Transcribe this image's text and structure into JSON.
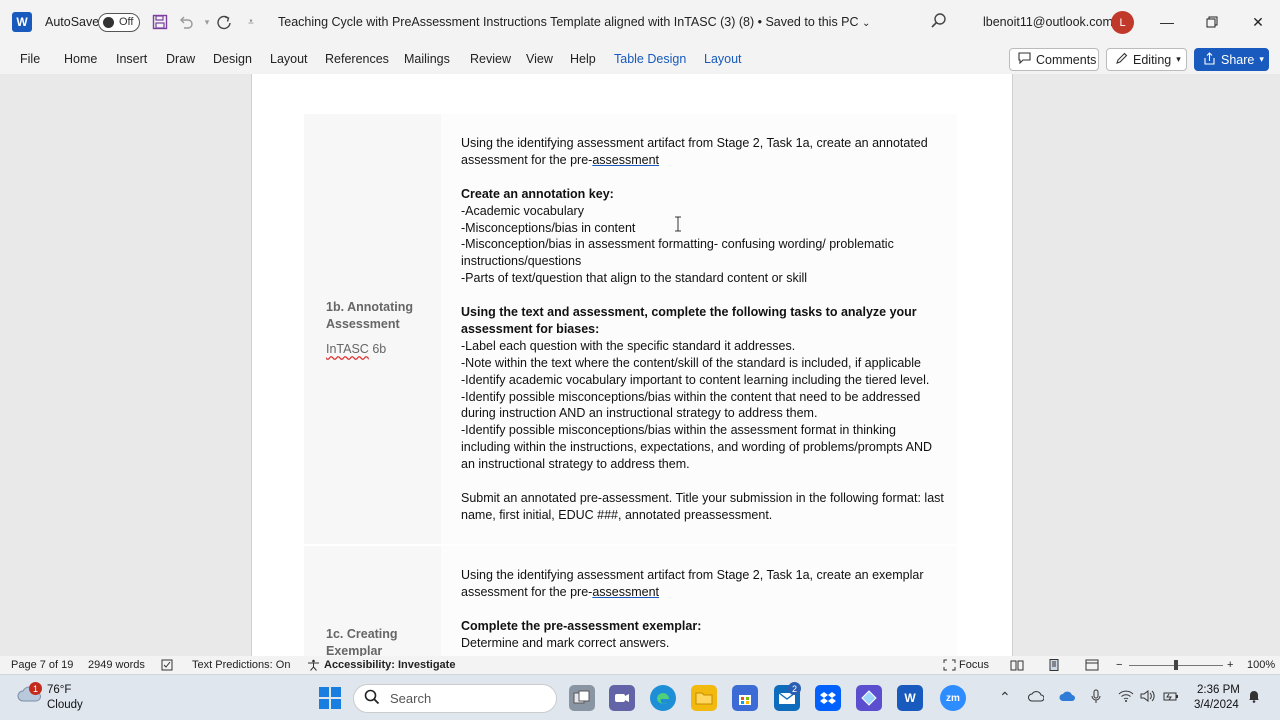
{
  "titlebar": {
    "app_icon_letter": "W",
    "autosave_label": "AutoSave",
    "autosave_state": "Off",
    "doc_title": "Teaching Cycle with PreAssessment Instructions Template aligned with InTASC (3) (8)  •  Saved to this PC",
    "account": "lbenoit11@outlook.com",
    "avatar_letter": "L"
  },
  "ribbon": {
    "tabs": [
      "File",
      "Home",
      "Insert",
      "Draw",
      "Design",
      "Layout",
      "References",
      "Mailings",
      "Review",
      "View",
      "Help",
      "Table Design",
      "Layout"
    ],
    "comments_label": "Comments",
    "editing_label": "Editing",
    "share_label": "Share"
  },
  "document": {
    "row1": {
      "label_line1": "1b. Annotating",
      "label_line2": "Assessment",
      "label_sub_a": "InTASC",
      "label_sub_b": " 6b",
      "intro_a": "Using the identifying assessment artifact from Stage 2, Task 1a, create an annotated",
      "intro_b": "assessment for the pre-",
      "intro_link": "assessment",
      "key_heading": "Create an annotation key:",
      "key_items": [
        "-Academic vocabulary",
        "-Misconceptions/bias in content",
        "-Misconception/bias in assessment formatting- confusing wording/ problematic",
        "instructions/questions",
        "-Parts of text/question that align to the standard content or skill"
      ],
      "tasks_heading_a": "Using the text and assessment, complete the following tasks to analyze your",
      "tasks_heading_b": "assessment for biases:",
      "tasks": [
        "-Label each question with the specific standard it addresses.",
        "-Note within the text where the content/skill of the standard is included, if applicable",
        "-Identify academic vocabulary important to content learning including the tiered level.",
        "-Identify possible misconceptions/bias within the content that need to be addressed",
        "during instruction AND an instructional strategy to address them.",
        "-Identify possible misconceptions/bias within the assessment format in thinking",
        "including within the instructions, expectations, and wording of problems/prompts AND",
        "an instructional strategy to address them."
      ],
      "submit_a": "Submit an annotated pre-assessment. Title your submission in the following format: last",
      "submit_b": "name, first initial, EDUC ###, annotated preassessment."
    },
    "row2": {
      "label_line1": "1c. Creating",
      "label_line2": "Exemplar",
      "intro_a": "Using the identifying assessment artifact from Stage 2, Task 1a, create an exemplar",
      "intro_b": "assessment for the pre-",
      "intro_link": "assessment",
      "heading": "Complete the pre-assessment exemplar:",
      "line1": "Determine and mark correct answers."
    }
  },
  "statusbar": {
    "page": "Page 7 of 19",
    "words": "2949 words",
    "predictions": "Text Predictions: On",
    "accessibility": "Accessibility: Investigate",
    "focus": "Focus",
    "zoom": "100%",
    "zoom_level": 1.0
  },
  "taskbar": {
    "temp": "76°F",
    "condition": "Cloudy",
    "weather_badge": "1",
    "search_placeholder": "Search",
    "store_badge": "2",
    "time": "2:36 PM",
    "date": "3/4/2024"
  },
  "colors": {
    "word_blue": "#185abd",
    "avatar_red": "#c0392b"
  }
}
